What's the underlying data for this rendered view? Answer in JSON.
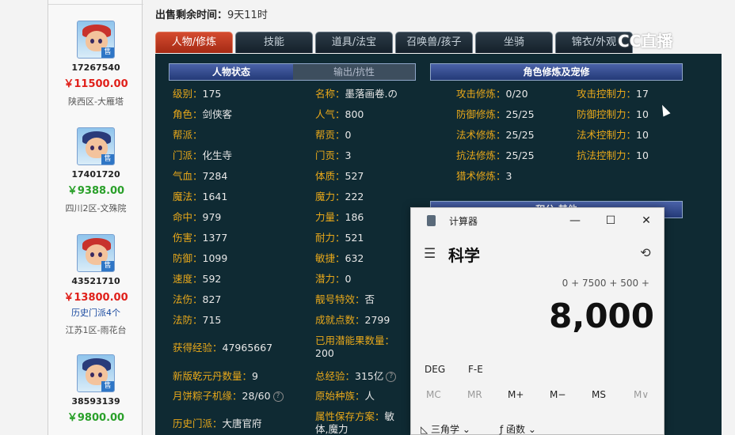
{
  "sidebar": {
    "sellers": [
      {
        "id": "17267540",
        "price": "￥11500.00",
        "price_color": "#e0201a",
        "server": "陕西区-大雁塔",
        "note": "",
        "hair": "#c8322c",
        "tag": "售"
      },
      {
        "id": "17401720",
        "price": "￥9388.00",
        "price_color": "#2aa02a",
        "server": "四川2区-文殊院",
        "note": "",
        "hair": "#2a3b7a",
        "tag": "售"
      },
      {
        "id": "43521710",
        "price": "￥13800.00",
        "price_color": "#e0201a",
        "server": "江苏1区-雨花台",
        "note": "历史门派4个",
        "hair": "#c8322c",
        "tag": "售"
      },
      {
        "id": "38593139",
        "price": "￥9800.00",
        "price_color": "#2aa02a",
        "server": "",
        "note": "",
        "hair": "#2a3b7a",
        "tag": "售"
      }
    ]
  },
  "sale_time": {
    "label": "出售剩余时间：",
    "value": "9天11时"
  },
  "tabs": [
    "人物/修炼",
    "技能",
    "道具/法宝",
    "召唤兽/孩子",
    "坐骑",
    "锦衣/外观"
  ],
  "watermark": "CC直播",
  "headers": {
    "status": "人物状态",
    "output": "输出/抗性",
    "cultivation": "角色修炼及宠修",
    "score": "积分·其他"
  },
  "stats_left": [
    {
      "label": "级别：",
      "value": "175"
    },
    {
      "label": "角色：",
      "value": "剑侠客"
    },
    {
      "label": "帮派：",
      "value": ""
    },
    {
      "label": "门派：",
      "value": "化生寺"
    },
    {
      "label": "气血：",
      "value": "7284"
    },
    {
      "label": "魔法：",
      "value": "1641"
    },
    {
      "label": "命中：",
      "value": "979"
    },
    {
      "label": "伤害：",
      "value": "1377"
    },
    {
      "label": "防御：",
      "value": "1099"
    },
    {
      "label": "速度：",
      "value": "592"
    },
    {
      "label": "法伤：",
      "value": "827"
    },
    {
      "label": "法防：",
      "value": "715"
    }
  ],
  "stats_mid": [
    {
      "label": "名称：",
      "value": "墨落画卷.の"
    },
    {
      "label": "人气：",
      "value": "800"
    },
    {
      "label": "帮贡：",
      "value": "0"
    },
    {
      "label": "门贡：",
      "value": "3"
    },
    {
      "label": "体质：",
      "value": "527"
    },
    {
      "label": "魔力：",
      "value": "222"
    },
    {
      "label": "力量：",
      "value": "186"
    },
    {
      "label": "耐力：",
      "value": "521"
    },
    {
      "label": "敏捷：",
      "value": "632"
    },
    {
      "label": "潜力：",
      "value": "0"
    },
    {
      "label": "靓号特效：",
      "value": "否"
    },
    {
      "label": "成就点数：",
      "value": "2799"
    }
  ],
  "cult_left": [
    {
      "label": "攻击修炼：",
      "value": "0/20"
    },
    {
      "label": "防御修炼：",
      "value": "25/25"
    },
    {
      "label": "法术修炼：",
      "value": "25/25"
    },
    {
      "label": "抗法修炼：",
      "value": "25/25"
    },
    {
      "label": "猎术修炼：",
      "value": "3"
    }
  ],
  "cult_right": [
    {
      "label": "攻击控制力：",
      "value": "17"
    },
    {
      "label": "防御控制力：",
      "value": "10"
    },
    {
      "label": "法术控制力：",
      "value": "10"
    },
    {
      "label": "抗法控制力：",
      "value": "10"
    }
  ],
  "extra": {
    "exp_label": "获得经验：",
    "exp_value": "47965667",
    "potion_label": "已用潜能果数量：",
    "potion_value": "200",
    "qiankun_label": "新版乾元丹数量：",
    "qiankun_value": "9",
    "total_exp_label": "总经验：",
    "total_exp_value": "315亿",
    "zongzi_label": "月饼粽子机缘：",
    "zongzi_value": "28/60",
    "race_label": "原始种族：",
    "race_value": "人",
    "history_label": "历史门派：",
    "history_value": "大唐官府",
    "attr_label": "属性保存方案：",
    "attr_value1": "敏",
    "attr_value2": "体,魔力"
  },
  "calculator": {
    "title": "计算器",
    "mode": "科学",
    "expression": "0 + 7500 + 500 +",
    "result": "8,000",
    "deg": "DEG",
    "fe": "F-E",
    "memory": [
      "MC",
      "MR",
      "M+",
      "M−",
      "MS",
      "M∨"
    ],
    "trig": "三角学",
    "func": "函数"
  }
}
